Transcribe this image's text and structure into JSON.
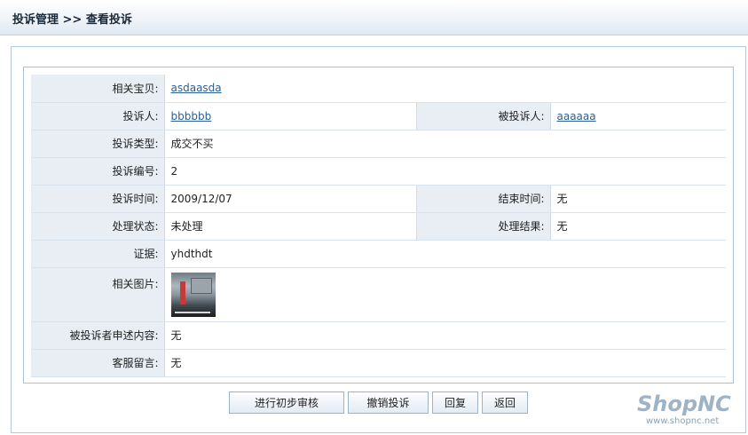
{
  "header": {
    "title": "投诉管理 >> 查看投诉"
  },
  "details": {
    "product_label": "相关宝贝:",
    "product_value": "asdaasda",
    "complainant_label": "投诉人:",
    "complainant_value": "bbbbbb",
    "respondent_label": "被投诉人:",
    "respondent_value": "aaaaaa",
    "type_label": "投诉类型:",
    "type_value": "成交不买",
    "number_label": "投诉编号:",
    "number_value": "2",
    "time_label": "投诉时间:",
    "time_value": "2009/12/07",
    "end_time_label": "结束时间:",
    "end_time_value": "无",
    "status_label": "处理状态:",
    "status_value": "未处理",
    "result_label": "处理结果:",
    "result_value": "无",
    "evidence_label": "证据:",
    "evidence_value": "yhdthdt",
    "images_label": "相关图片:",
    "statement_label": "被投诉者申述内容:",
    "statement_value": "无",
    "service_label": "客服留言:",
    "service_value": "无"
  },
  "buttons": {
    "review": "进行初步审核",
    "revoke": "撤销投诉",
    "reply": "回复",
    "back": "返回"
  },
  "logo": {
    "brand": "ShopNC",
    "url": "www.shopnc.net"
  },
  "colors": {
    "label_bg": "#e8eef4",
    "link": "#2b5f93",
    "border": "#a9c0d6"
  }
}
